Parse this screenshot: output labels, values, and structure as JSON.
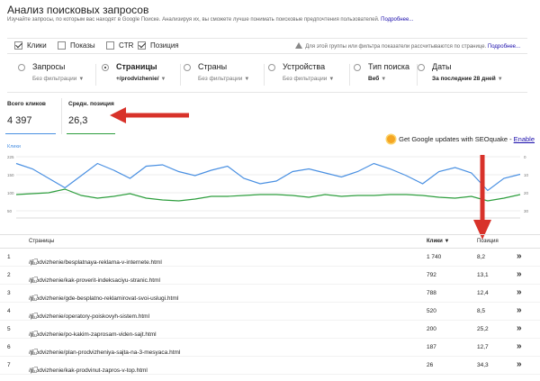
{
  "header": {
    "title": "Анализ поисковых запросов",
    "subtitle": "Изучайте запросы, по которым вас находят в Google Поиске. Анализируя их, вы сможете лучше понимать поисковые предпочтения пользователей.",
    "more_link": "Подробнее..."
  },
  "metrics": {
    "items": [
      {
        "label": "Клики",
        "checked": true
      },
      {
        "label": "Показы",
        "checked": false
      },
      {
        "label": "CTR",
        "checked": false
      },
      {
        "label": "Позиция",
        "checked": true
      }
    ],
    "note": "Для этой группы или фильтра показатели рассчитываются по странице.",
    "note_link": "Подробнее..."
  },
  "filters": [
    {
      "label": "Запросы",
      "sub": "Без фильтрации",
      "selected": false
    },
    {
      "label": "Страницы",
      "sub": "+/prodvizhenie/",
      "selected": true
    },
    {
      "label": "Страны",
      "sub": "Без фильтрации",
      "selected": false
    },
    {
      "label": "Устройства",
      "sub": "Без фильтрации",
      "selected": false
    },
    {
      "label": "Тип поиска",
      "sub": "Веб",
      "selected": false
    },
    {
      "label": "Даты",
      "sub": "За последние 28 дней",
      "selected": false
    }
  ],
  "totals": [
    {
      "label": "Всего кликов",
      "value": "4 397",
      "color": "#4a90e2"
    },
    {
      "label": "Средн. позиция",
      "value": "26,3",
      "color": "#2e9e3e"
    }
  ],
  "seoquake": {
    "text": "Get Google updates with SEOquake -",
    "link": "Enable"
  },
  "chart": {
    "legend": "Клики",
    "left_ticks": [
      "225",
      "150",
      "100",
      "50"
    ],
    "right_ticks": [
      "0",
      "10",
      "20",
      "30"
    ]
  },
  "chart_data": {
    "type": "line",
    "series": [
      {
        "name": "Клики",
        "color": "#4a90e2",
        "values": [
          225,
          205,
          170,
          135,
          180,
          225,
          200,
          170,
          215,
          220,
          195,
          180,
          200,
          215,
          170,
          150,
          160,
          195,
          205,
          190,
          175,
          195,
          225,
          205,
          180,
          150,
          195,
          210,
          190,
          125,
          170,
          185
        ]
      },
      {
        "name": "Позиция",
        "color": "#2e9e3e",
        "values": [
          21,
          20.5,
          20,
          18,
          21.5,
          23,
          22,
          20.5,
          23,
          24,
          24.5,
          23.5,
          22,
          22,
          21.5,
          21,
          21,
          21.5,
          22.5,
          21,
          22,
          21.5,
          21.5,
          21,
          21,
          21.5,
          22.5,
          23,
          22,
          24.5,
          23,
          21
        ]
      }
    ]
  },
  "table": {
    "columns": [
      "Страницы",
      "Клики ▼",
      "Позиция"
    ],
    "rows": [
      {
        "n": "1",
        "page": "/prodvizhenie/besplatnaya-reklama-v-internete.html",
        "clicks": "1 740",
        "position": "8,2"
      },
      {
        "n": "2",
        "page": "/prodvizhenie/kak-proverit-indeksaciyu-stranic.html",
        "clicks": "792",
        "position": "13,1"
      },
      {
        "n": "3",
        "page": "/prodvizhenie/gde-besplatno-reklamirovat-svoi-uslugi.html",
        "clicks": "788",
        "position": "12,4"
      },
      {
        "n": "4",
        "page": "/prodvizhenie/operatory-poiskovyh-sistem.html",
        "clicks": "520",
        "position": "8,5"
      },
      {
        "n": "5",
        "page": "/prodvizhenie/po-kakim-zaprosam-viden-sajt.html",
        "clicks": "200",
        "position": "25,2"
      },
      {
        "n": "6",
        "page": "/prodvizhenie/plan-prodvizheniya-sajta-na-3-mesyaca.html",
        "clicks": "187",
        "position": "12,7"
      },
      {
        "n": "7",
        "page": "/prodvizhenie/kak-prodvinut-zapros-v-top.html",
        "clicks": "26",
        "position": "34,3"
      }
    ]
  }
}
